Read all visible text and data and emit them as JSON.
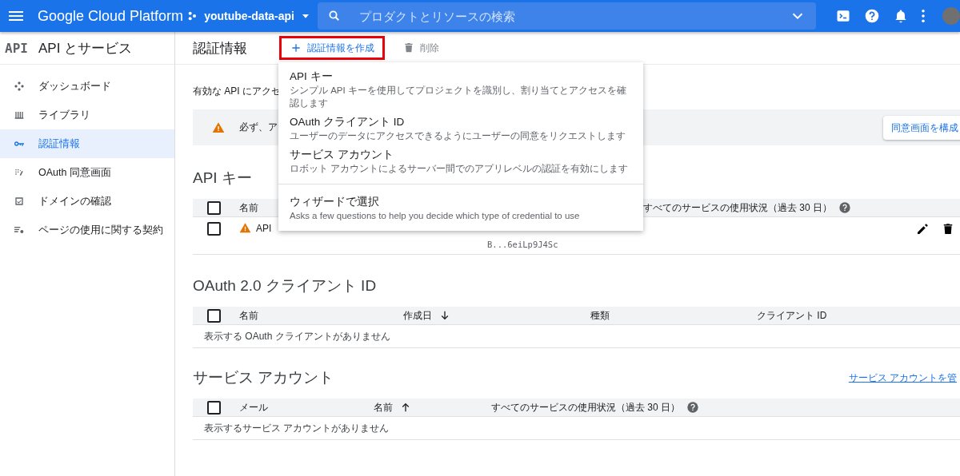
{
  "topbar": {
    "product": "Google Cloud Platform",
    "project": "youtube-data-api",
    "search": {
      "placeholder": "プロダクトとリソースの検索"
    }
  },
  "sidebar": {
    "logo": "API",
    "title": "API とサービス",
    "items": [
      {
        "label": "ダッシュボード",
        "selected": false
      },
      {
        "label": "ライブラリ",
        "selected": false
      },
      {
        "label": "認証情報",
        "selected": true
      },
      {
        "label": "OAuth 同意画面",
        "selected": false
      },
      {
        "label": "ドメインの確認",
        "selected": false
      },
      {
        "label": "ページの使用に関する契約",
        "selected": false
      }
    ]
  },
  "header": {
    "title": "認証情報",
    "create_button": "認証情報を作成",
    "delete_button": "削除"
  },
  "intro": "有効な API にアクセ",
  "banner": {
    "text": "必ず、ア",
    "button": "同意画面を構成"
  },
  "menu": [
    {
      "kind": "option",
      "title": "API キー",
      "description": "シンプル API キーを使用してプロジェクトを識別し、割り当てとアクセスを確認します"
    },
    {
      "kind": "option",
      "title": "OAuth クライアント ID",
      "description": "ユーザーのデータにアクセスできるようにユーザーの同意をリクエストします"
    },
    {
      "kind": "option",
      "title": "サービス アカウント",
      "description": "ロボット アカウントによるサーバー間でのアプリレベルの認証を有効にします"
    },
    {
      "kind": "wizard",
      "title": "ウィザードで選択",
      "description": "Asks a few questions to help you decide which type of credential to use"
    }
  ],
  "api_keys": {
    "title": "API キー",
    "header_checked": false,
    "columns": [
      {
        "label": "名前"
      },
      {
        "label": "すべてのサービスの使用状況（過去 30 日）",
        "help": true
      }
    ],
    "rows": [
      {
        "checked": false,
        "warning": true,
        "name": "API",
        "key": "B...6eiLp9J4Sc"
      }
    ]
  },
  "oauth": {
    "title": "OAuth 2.0 クライアント ID",
    "header_checked": false,
    "columns": [
      {
        "label": "名前"
      },
      {
        "label": "作成日",
        "sorted": true,
        "descending": true
      },
      {
        "label": "種類"
      },
      {
        "label": "クライアント ID"
      }
    ],
    "empty": "表示する OAuth クライアントがありません"
  },
  "service_accounts": {
    "title": "サービス アカウント",
    "link": "サービス アカウントを管",
    "header_checked": false,
    "columns": [
      {
        "label": "メール"
      },
      {
        "label": "名前",
        "sorted": true,
        "descending": false
      },
      {
        "label": "すべてのサービスの使用状況（過去 30 日）",
        "help": true
      }
    ],
    "empty": "表示するサービス アカウントがありません"
  }
}
